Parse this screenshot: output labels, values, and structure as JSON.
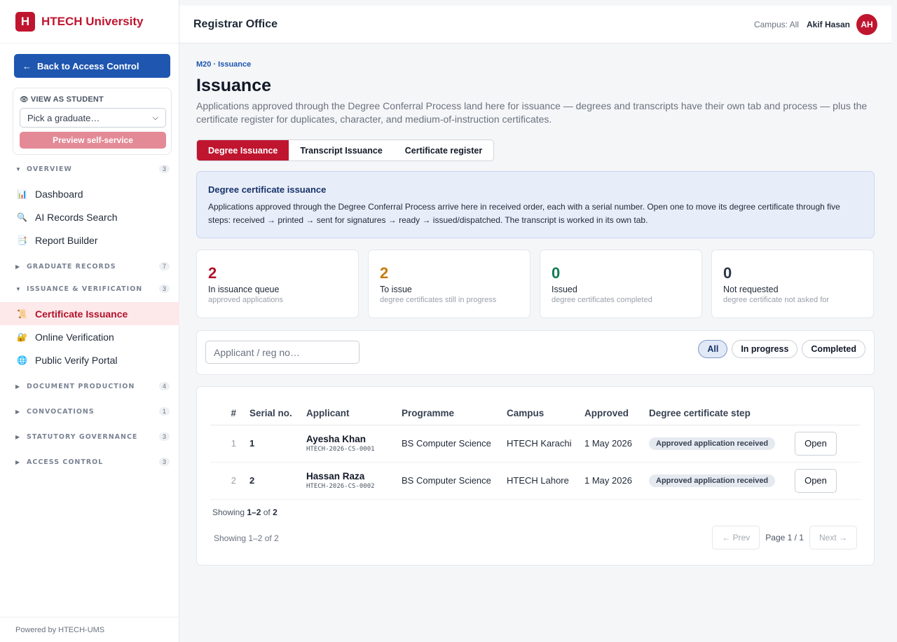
{
  "brand": {
    "logo_letter": "H",
    "name": "HTECH University"
  },
  "sidebar": {
    "back_label": "Back to Access Control",
    "back_arrow": "←",
    "view_as_student": {
      "title": "VIEW AS STUDENT",
      "select_value": "Pick a graduate…",
      "preview_label": "Preview self-service"
    },
    "sections": [
      {
        "label": "OVERVIEW",
        "count": "3",
        "expanded": true,
        "items": [
          {
            "label": "Dashboard",
            "icon": "bar-chart-icon",
            "glyph": "📊"
          },
          {
            "label": "AI Records Search",
            "icon": "magnifier-icon",
            "glyph": "🔍"
          },
          {
            "label": "Report Builder",
            "icon": "report-icon",
            "glyph": "📑"
          }
        ]
      },
      {
        "label": "GRADUATE RECORDS",
        "count": "7",
        "expanded": false
      },
      {
        "label": "ISSUANCE & VERIFICATION",
        "count": "3",
        "expanded": true,
        "items": [
          {
            "label": "Certificate Issuance",
            "icon": "scroll-icon",
            "glyph": "📜",
            "active": true
          },
          {
            "label": "Online Verification",
            "icon": "lock-icon",
            "glyph": "🔐"
          },
          {
            "label": "Public Verify Portal",
            "icon": "globe-icon",
            "glyph": "🌐"
          }
        ]
      },
      {
        "label": "DOCUMENT PRODUCTION",
        "count": "4",
        "expanded": false
      },
      {
        "label": "CONVOCATIONS",
        "count": "1",
        "expanded": false
      },
      {
        "label": "STATUTORY GOVERNANCE",
        "count": "3",
        "expanded": false
      },
      {
        "label": "ACCESS CONTROL",
        "count": "3",
        "expanded": false
      }
    ],
    "footer": "Powered by HTECH-UMS"
  },
  "header": {
    "title": "Registrar Office",
    "campus": "Campus: All",
    "user": "Akif Hasan",
    "avatar_initials": "AH"
  },
  "main": {
    "breadcrumb": "M20 · Issuance",
    "title": "Issuance",
    "subtitle": "Applications approved through the Degree Conferral Process land here for issuance — degrees and transcripts have their own tab and process — plus the certificate register for duplicates, character, and medium-of-instruction certificates.",
    "tabs": [
      {
        "label": "Degree Issuance",
        "active": true
      },
      {
        "label": "Transcript Issuance",
        "active": false
      },
      {
        "label": "Certificate register",
        "active": false
      }
    ],
    "info": {
      "title": "Degree certificate issuance",
      "body": "Applications approved through the Degree Conferral Process arrive here in received order, each with a serial number. Open one to move its degree certificate through five steps: received → printed → sent for signatures → ready → issued/dispatched. The transcript is worked in its own tab."
    },
    "stats": [
      {
        "value": "2",
        "label": "In issuance queue",
        "sub": "approved applications",
        "color": "#b1122b"
      },
      {
        "value": "2",
        "label": "To issue",
        "sub": "degree certificates still in progress",
        "color": "#c77a0a"
      },
      {
        "value": "0",
        "label": "Issued",
        "sub": "degree certificates completed",
        "color": "#137a52"
      },
      {
        "value": "0",
        "label": "Not requested",
        "sub": "degree certificate not asked for",
        "color": "#2d3748"
      }
    ],
    "search_placeholder": "Applicant / reg no…",
    "filters": [
      {
        "label": "All",
        "active": true
      },
      {
        "label": "In progress",
        "active": false
      },
      {
        "label": "Completed",
        "active": false
      }
    ],
    "table": {
      "columns": [
        "#",
        "Serial no.",
        "Applicant",
        "Programme",
        "Campus",
        "Approved",
        "Degree certificate step",
        ""
      ],
      "rows": [
        {
          "idx": "1",
          "serial": "1",
          "name": "Ayesha Khan",
          "reg": "HTECH-2026-CS-0001",
          "programme": "BS Computer Science",
          "campus": "HTECH Karachi",
          "approved": "1 May 2026",
          "step": "Approved application received",
          "action": "Open"
        },
        {
          "idx": "2",
          "serial": "2",
          "name": "Hassan Raza",
          "reg": "HTECH-2026-CS-0002",
          "programme": "BS Computer Science",
          "campus": "HTECH Lahore",
          "approved": "1 May 2026",
          "step": "Approved application received",
          "action": "Open"
        }
      ]
    },
    "showing_prefix": "Showing ",
    "showing_range": "1–2",
    "showing_of": " of ",
    "showing_total": "2",
    "showing_text": "Showing 1–2 of 2",
    "pager": {
      "prev": "← Prev",
      "info": "Page 1 / 1",
      "next": "Next →"
    }
  },
  "colors": {
    "brand_red": "#c0152f",
    "primary_blue": "#1e56b0"
  }
}
